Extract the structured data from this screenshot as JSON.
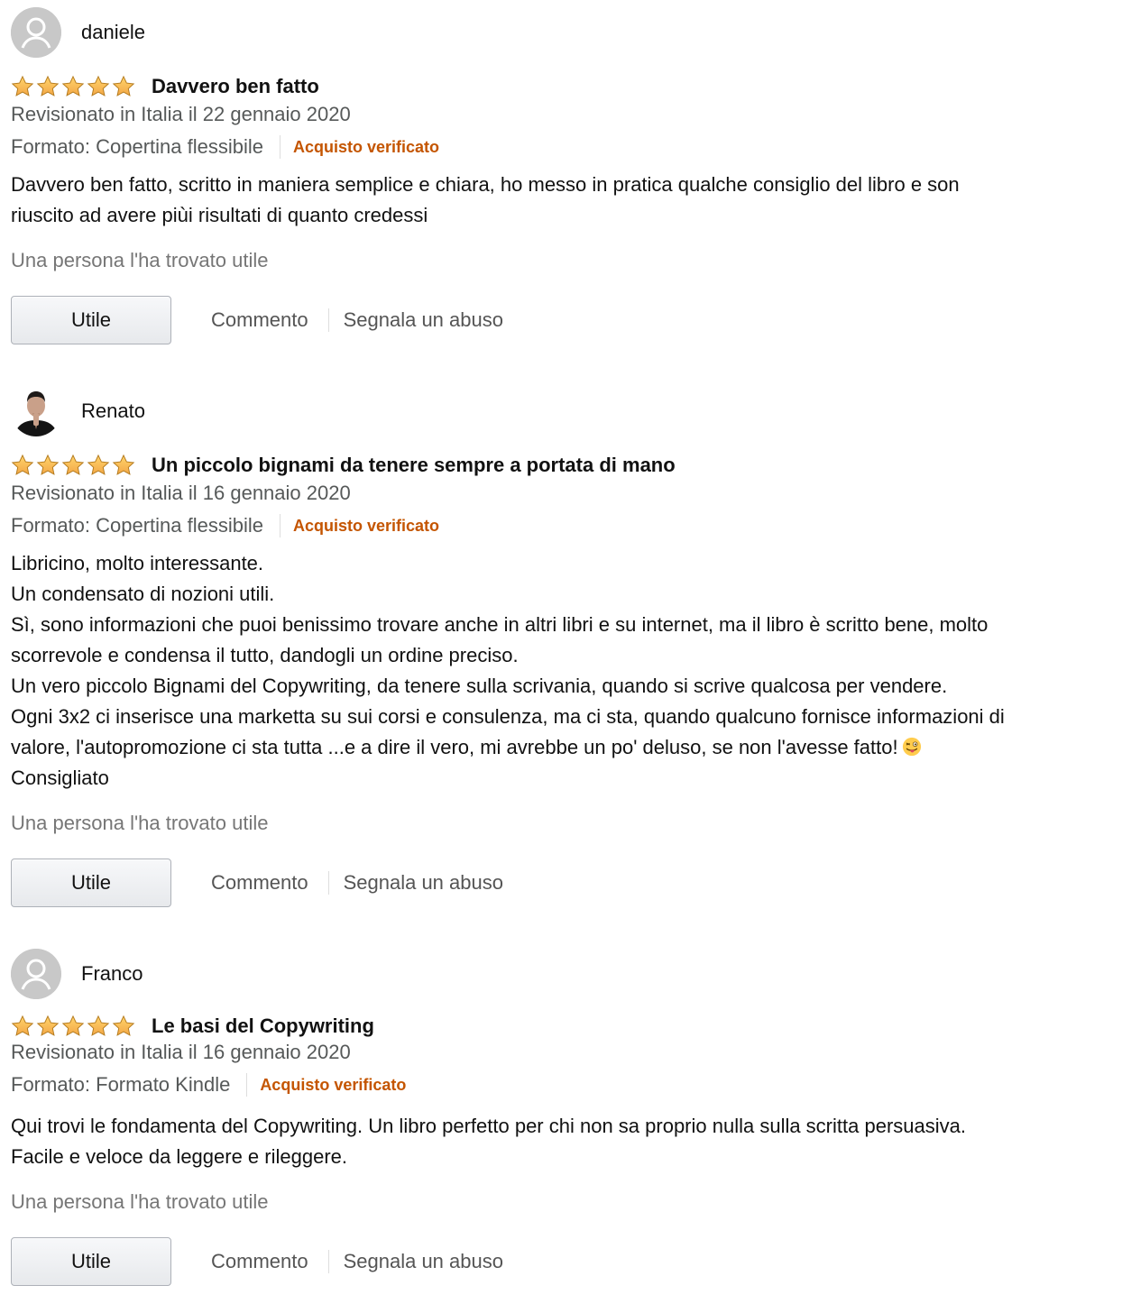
{
  "colors": {
    "star": "#f3a847",
    "verified": "#c45500",
    "meta_text": "#565959",
    "helpful_text": "#767676",
    "link_text": "#555555",
    "avatar_default": "#c8c8c8"
  },
  "reviews": [
    {
      "author": "daniele",
      "avatar": "default-profile-icon",
      "stars": 5,
      "title": "Davvero ben fatto",
      "date": "Revisionato in Italia il 22 gennaio 2020",
      "format": "Formato: Copertina flessibile",
      "verified": "Acquisto verificato",
      "body_lines": [
        "Davvero ben fatto, scritto in maniera semplice e chiara, ho messo in pratica qualche consiglio del libro e son",
        "riuscito ad avere piùi risultati di quanto credessi"
      ],
      "helpful_text": "Una persona l'ha trovato utile",
      "helpful_button": "Utile",
      "comment_link": "Commento",
      "report_link": "Segnala un abuso"
    },
    {
      "author": "Renato",
      "avatar": "user-photo",
      "stars": 5,
      "title": "Un piccolo bignami da tenere sempre a portata di mano",
      "date": "Revisionato in Italia il 16 gennaio 2020",
      "format": "Formato: Copertina flessibile",
      "verified": "Acquisto verificato",
      "body_lines": [
        "Libricino, molto interessante.",
        "Un condensato di nozioni utili.",
        "Sì, sono informazioni che puoi benissimo trovare anche in altri libri e su internet, ma il libro è scritto bene, molto",
        "scorrevole e condensa il tutto, dandogli un ordine preciso.",
        "Un vero piccolo Bignami del Copywriting, da tenere sulla scrivania, quando si scrive qualcosa per vendere.",
        "Ogni 3x2 ci inserisce una marketta su sui corsi e consulenza, ma ci sta, quando qualcuno fornisce informazioni di",
        "valore, l'autopromozione ci sta tutta ...e a dire il vero, mi avrebbe un po' deluso, se non l'avesse fatto!",
        "Consigliato"
      ],
      "emoji": "winking-face-with-tongue-icon",
      "helpful_text": "Una persona l'ha trovato utile",
      "helpful_button": "Utile",
      "comment_link": "Commento",
      "report_link": "Segnala un abuso"
    },
    {
      "author": "Franco",
      "avatar": "default-profile-icon",
      "stars": 5,
      "title": "Le basi del Copywriting",
      "date": "Revisionato in Italia il 16 gennaio 2020",
      "format": "Formato: Formato Kindle",
      "verified": "Acquisto verificato",
      "body_lines": [
        "Qui trovi le fondamenta del Copywriting. Un libro perfetto per chi non sa proprio nulla sulla scritta persuasiva.",
        "Facile e veloce da leggere e rileggere."
      ],
      "helpful_text": "Una persona l'ha trovato utile",
      "helpful_button": "Utile",
      "comment_link": "Commento",
      "report_link": "Segnala un abuso"
    }
  ]
}
